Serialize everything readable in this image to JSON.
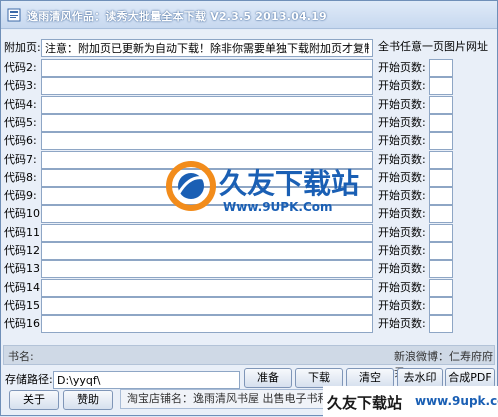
{
  "window": {
    "title": "逸雨清风作品：读秀大批量全本下载 V2.3.5  2013.04.19"
  },
  "addon": {
    "label": "附加页:",
    "value": "注意：附加页已更新为自动下载！除非你需要单独下载附加页才复制代码到此",
    "right_note": "全书任意一页图片网址"
  },
  "code_rows": [
    {
      "label": "代码2:",
      "page_label": "开始页数:"
    },
    {
      "label": "代码3:",
      "page_label": "开始页数:"
    },
    {
      "label": "代码4:",
      "page_label": "开始页数:"
    },
    {
      "label": "代码5:",
      "page_label": "开始页数:"
    },
    {
      "label": "代码6:",
      "page_label": "开始页数:"
    },
    {
      "label": "代码7:",
      "page_label": "开始页数:"
    },
    {
      "label": "代码8:",
      "page_label": "开始页数:"
    },
    {
      "label": "代码9:",
      "page_label": "开始页数:"
    },
    {
      "label": "代码10:",
      "page_label": "开始页数:"
    },
    {
      "label": "代码11:",
      "page_label": "开始页数:"
    },
    {
      "label": "代码12:",
      "page_label": "开始页数:"
    },
    {
      "label": "代码13:",
      "page_label": "开始页数:"
    },
    {
      "label": "代码14:",
      "page_label": "开始页数:"
    },
    {
      "label": "代码15:",
      "page_label": "开始页数:"
    },
    {
      "label": "代码16:",
      "page_label": "开始页数:"
    }
  ],
  "bookname": {
    "label": "书名:",
    "weibo": "新浪微博：仁寿府府尹"
  },
  "path": {
    "label": "存储路径:",
    "value": "D:\\yyqf\\"
  },
  "buttons": {
    "prepare": "准备",
    "download": "下载",
    "clear": "清空",
    "remove_watermark": "去水印",
    "merge_pdf": "合成PDF",
    "about": "关于",
    "donate": "赞助"
  },
  "shop": {
    "text": "淘宝店铺名：逸雨清风书屋  出售电子书和"
  },
  "watermark": {
    "logo_text": "久友下载站",
    "url": "Www.9UPK.Com",
    "bottom_text": "久友下载站",
    "bottom_url": "www.9upk.com"
  },
  "colors": {
    "title_gradient_top": "#dfeaf8",
    "watermark_blue": "#1a5fb4",
    "watermark_orange": "#f28c1b"
  }
}
